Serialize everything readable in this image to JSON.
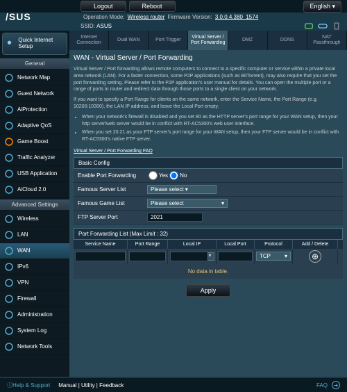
{
  "top": {
    "logout": "Logout",
    "reboot": "Reboot",
    "english": "English"
  },
  "info": {
    "opmode_lbl": "Operation Mode:",
    "opmode": "Wireless router",
    "fw_lbl": "Firmware Version:",
    "fw": "3.0.0.4.380_1574",
    "ssid_lbl": "SSID:",
    "ssid": "ASUS"
  },
  "logo": "/SUS",
  "qis": "Quick Internet Setup",
  "sh1": "General",
  "sh2": "Advanced Settings",
  "side1": [
    "Network Map",
    "Guest Network",
    "AiProtection",
    "Adaptive QoS",
    "Game Boost",
    "Traffic Analyzer",
    "USB Application",
    "AiCloud 2.0"
  ],
  "side2": [
    "Wireless",
    "LAN",
    "WAN",
    "IPv6",
    "VPN",
    "Firewall",
    "Administration",
    "System Log",
    "Network Tools"
  ],
  "tabs": [
    "Internet Connection",
    "Dual WAN",
    "Port Trigger",
    "Virtual Server / Port Forwarding",
    "DMZ",
    "DDNS",
    "NAT Passthrough"
  ],
  "title": "WAN - Virtual Server / Port Forwarding",
  "p1": "Virtual Server / Port forwarding allows remote computers to connect to a specific computer or service within a private local area network (LAN). For a faster connection, some P2P applications (such as BitTorrent), may also require that you set the port forwarding setting. Please refer to the P2P application's user manual for details. You can open the multiple port or a range of ports in router and redirect data through those ports to a single client on your network.",
  "p2": "If you want to specify a Port Range for clients on the same network, enter the Service Name, the Port Range (e.g. 10200:10300), the LAN IP address, and leave the Local Port empty.",
  "li1": "When your network's firewall is disabled and you set 80 as the HTTP server's port range for your WAN setup, then your http server/web server would be in conflict with RT-AC5300's web user interface.",
  "li2": "When you set 20:21 as your FTP server's port range for your WAN setup, then your FTP server would be in conflict with RT-AC5300's native FTP server.",
  "faq": "Virtual Server / Port Forwarding FAQ",
  "bc": "Basic Config",
  "f1": "Enable Port Forwarding",
  "yes": "Yes",
  "no": "No",
  "f2": "Famous Server List",
  "f2v": "Please select ▾",
  "f3": "Famous Game List",
  "f3v": "Please select",
  "f4": "FTP Server Port",
  "f4v": "2021",
  "plh": "Port Forwarding List (Max Limit : 32)",
  "cols": [
    "Service Name",
    "Port Range",
    "Local IP",
    "Local Port",
    "Protocol",
    "Add / Delete"
  ],
  "proto": "TCP",
  "nodata": "No data in table.",
  "apply": "Apply",
  "foot": {
    "help": "Help & Support",
    "links": "Manual | Utility | Feedback",
    "faq": "FAQ"
  }
}
